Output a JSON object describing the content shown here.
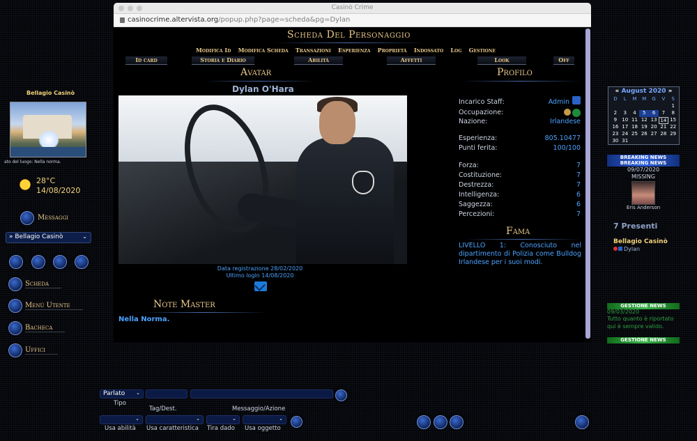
{
  "left": {
    "location_title": "Bellagio Casinò",
    "location_status": "ato del luogo: Nella norma.",
    "temperature": "28°C",
    "date": "14/08/2020",
    "messages_label": "Messaggi",
    "location_select": "» Bellagio Casinò",
    "nav": [
      "Scheda",
      "Menù Utente",
      "Bacheca",
      "Uffici"
    ]
  },
  "browser": {
    "window_title": "Casinò Crime",
    "url_host": "casinocrime.altervista.org",
    "url_path": "/popup.php?page=scheda&pg=Dylan"
  },
  "sheet": {
    "title": "Scheda Del Personaggio",
    "top_menu": [
      "Modifica Id",
      "Modifica Scheda",
      "Transazioni",
      "Esperienza",
      "Proprietà",
      "Indossato",
      "Log",
      "Gestione"
    ],
    "tabs": [
      "Id card",
      "Storia e Diario",
      "Abilità",
      "Affetti",
      "Look",
      "Off"
    ],
    "avatar_heading": "Avatar",
    "character_name": "Dylan O'Hara",
    "registration": "Data registrazione 28/02/2020",
    "last_login": "Ultimo login 14/08/2020",
    "notes_heading": "Note Master",
    "notes_text": "Nella Norma.",
    "profile_heading": "Profilo",
    "profile": [
      {
        "k": "Incarico Staff:",
        "v": "Admin"
      },
      {
        "k": "Occupazione:",
        "v": ""
      },
      {
        "k": "Nazione:",
        "v": "Irlandese"
      }
    ],
    "stats_a": [
      {
        "k": "Esperienza:",
        "v": "805.10477"
      },
      {
        "k": "Punti ferita:",
        "v": "100/100"
      }
    ],
    "stats_b": [
      {
        "k": "Forza:",
        "v": "7"
      },
      {
        "k": "Costituzione:",
        "v": "7"
      },
      {
        "k": "Destrezza:",
        "v": "7"
      },
      {
        "k": "Intelligenza:",
        "v": "6"
      },
      {
        "k": "Saggezza:",
        "v": "6"
      },
      {
        "k": "Percezioni:",
        "v": "7"
      }
    ],
    "fama_heading": "Fama",
    "fama_text": "LIVELLO 1: Conosciuto nel dipartimento di Polizia come Bulldog Irlandese per i suoi modi."
  },
  "calendar": {
    "month": "August 2020",
    "prev": "«",
    "next": "»",
    "day_headers": [
      "D",
      "L",
      "M",
      "M",
      "G",
      "V",
      "S"
    ],
    "days": [
      "",
      "",
      "",
      "",
      "",
      "",
      "1",
      "2",
      "3",
      "4",
      "5",
      "6",
      "7",
      "8",
      "9",
      "10",
      "11",
      "12",
      "13",
      "14",
      "15",
      "16",
      "17",
      "18",
      "19",
      "20",
      "21",
      "22",
      "23",
      "24",
      "25",
      "26",
      "27",
      "28",
      "29",
      "30",
      "31"
    ]
  },
  "news": {
    "breaking1": "BREAKING NEWS",
    "breaking2": "BREAKING NEWS",
    "date": "09/07/2020",
    "headline": "MISSING",
    "name": "Eris Anderson"
  },
  "presence": {
    "count_label": "7 Presenti",
    "location": "Bellagio Casinò",
    "user": "Dylan"
  },
  "gestione": {
    "bar1": "GESTIONE NEWS",
    "date": "09/03/2020",
    "text": "Tutto quanto è riportato qui è sempre valido.",
    "bar2": "GESTIONE NEWS"
  },
  "chat": {
    "type_value": "Parlato",
    "type_label": "Tipo",
    "tag_label": "Tag/Dest.",
    "message_label": "Messaggio/Azione",
    "abilita_label": "Usa abilità",
    "caratteristica_label": "Usa caratteristica",
    "dado_label": "Tira dado",
    "oggetto_label": "Usa oggetto"
  }
}
